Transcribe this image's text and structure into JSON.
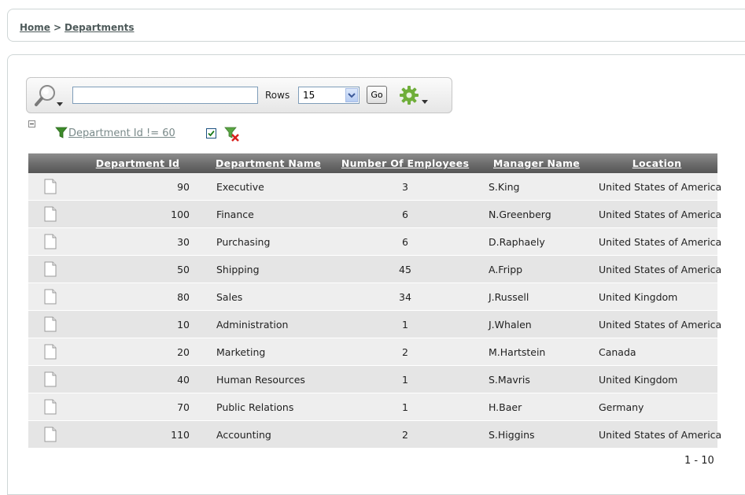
{
  "breadcrumb": {
    "home": "Home",
    "separator": ">",
    "current": "Departments"
  },
  "toolbar": {
    "search_value": "",
    "rows_label": "Rows",
    "rows_value": "15",
    "go_label": "Go",
    "search_icon": "magnifier-icon",
    "actions_icon": "gear-icon"
  },
  "filter": {
    "text": "Department Id != 60",
    "enabled": true
  },
  "table": {
    "columns": [
      "Department Id",
      "Department Name",
      "Number Of Employees",
      "Manager Name",
      "Location"
    ],
    "rows": [
      [
        "90",
        "Executive",
        "3",
        "S.King",
        "United States of America"
      ],
      [
        "100",
        "Finance",
        "6",
        "N.Greenberg",
        "United States of America"
      ],
      [
        "30",
        "Purchasing",
        "6",
        "D.Raphaely",
        "United States of America"
      ],
      [
        "50",
        "Shipping",
        "45",
        "A.Fripp",
        "United States of America"
      ],
      [
        "80",
        "Sales",
        "34",
        "J.Russell",
        "United Kingdom"
      ],
      [
        "10",
        "Administration",
        "1",
        "J.Whalen",
        "United States of America"
      ],
      [
        "20",
        "Marketing",
        "2",
        "M.Hartstein",
        "Canada"
      ],
      [
        "40",
        "Human Resources",
        "1",
        "S.Mavris",
        "United Kingdom"
      ],
      [
        "70",
        "Public Relations",
        "1",
        "H.Baer",
        "Germany"
      ],
      [
        "110",
        "Accounting",
        "2",
        "S.Higgins",
        "United States of America"
      ]
    ]
  },
  "pagination": {
    "text": "1 - 10"
  }
}
